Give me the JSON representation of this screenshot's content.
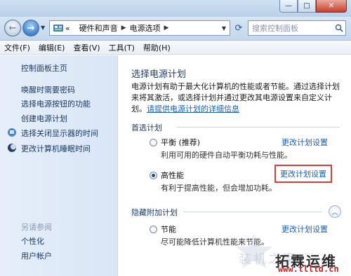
{
  "window": {
    "min": "—",
    "max": "□",
    "close": "✕"
  },
  "nav": {
    "breadcrumb": [
      "«",
      "硬件和声音",
      "电源选项"
    ],
    "search_placeholder": "搜索控制面板"
  },
  "menu": [
    "文件(F)",
    "编辑(E)",
    "查看(V)",
    "工具(T)",
    "帮助(H)"
  ],
  "sidebar": {
    "home": "控制面板主页",
    "links": [
      "唤醒时需要密码",
      "选择电源按钮的功能",
      "创建电源计划",
      "选择关闭显示器的时间",
      "更改计算机睡眠时间"
    ],
    "see_also": "另请参阅",
    "see_links": [
      "个性化",
      "用户帐户"
    ]
  },
  "main": {
    "heading": "选择电源计划",
    "desc": "电源计划有助于最大化计算机的性能或者节能。通过选择计划来将其激活，或选择计划并通过更改其电源设置来自定义计划。",
    "desc_link": "请提供电源计划的详细信息",
    "preferred_label": "首选计划",
    "hidden_label": "隐藏附加计划",
    "plans": [
      {
        "name": "平衡 (推荐)",
        "desc": "利用可用的硬件自动平衡功耗与性能。",
        "link": "更改计划设置",
        "selected": false
      },
      {
        "name": "高性能",
        "desc": "有利于提高性能，但会增加功耗。",
        "link": "更改计划设置",
        "selected": true
      },
      {
        "name": "节能",
        "desc": "尽可能降低计算机性能来节能。",
        "link": "更改计划设置",
        "selected": false
      }
    ]
  },
  "watermark": {
    "text": "拓霖运维",
    "url": "www.tlltd.cn",
    "faint": "装机之家"
  }
}
